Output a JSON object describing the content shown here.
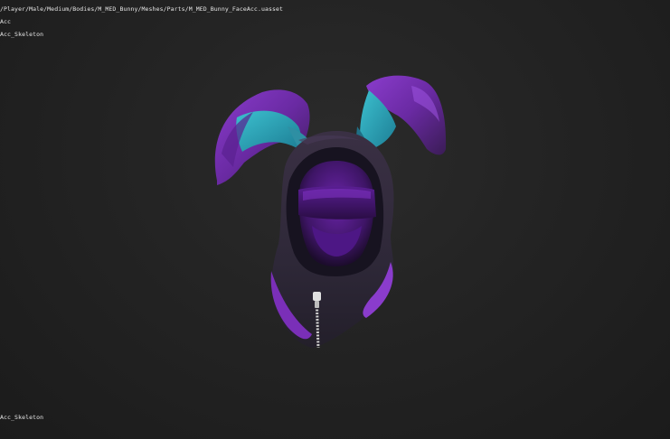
{
  "viewer": {
    "asset_path": "/Player/Male/Medium/Bodies/M_MED_Bunny/Meshes/Parts/M_MED_Bunny_FaceAcc.uasset",
    "mesh_label": "Acc",
    "skeleton_label": "Acc_Skeleton",
    "footer_label": "Acc_Skeleton"
  },
  "model": {
    "subject": "bunny-eared hood with face mask",
    "colors": {
      "background": "#242424",
      "purple": "#7a2fb8",
      "purple_dark": "#3a1c55",
      "shadow": "#2a2630",
      "teal": "#2aa6b8",
      "mask": "#4a1a7a",
      "zipper": "#d8d8d8"
    }
  }
}
